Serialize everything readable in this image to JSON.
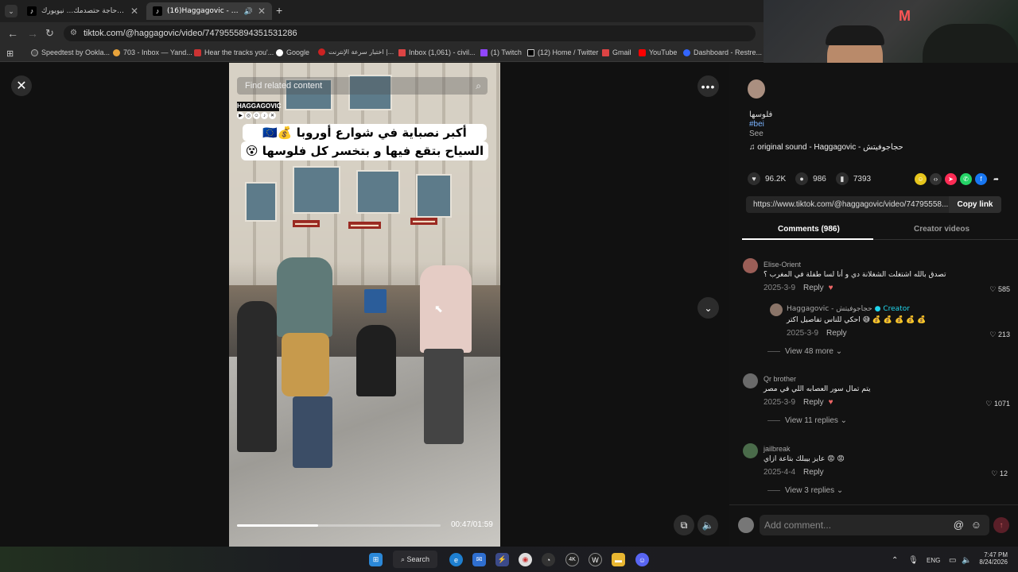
{
  "browser": {
    "tabs": [
      {
        "title": "أكثر حاجة حتصدمك... نيويورك ..."
      },
      {
        "title": "(16)Haggagovic - حجاجوفيتش"
      }
    ],
    "url": "tiktok.com/@haggagovic/video/7479555894351531286",
    "bookmarks": [
      "Speedtest by Ookla...",
      "703 - Inbox — Yand...",
      "Hear the tracks you'...",
      "Google",
      "اختبار سرعة الإنترنت |...",
      "Inbox (1,061) - civil...",
      "(1) Twitch",
      "(12) Home / Twitter",
      "Gmail",
      "YouTube",
      "Dashboard - Restre..."
    ]
  },
  "video": {
    "search_placeholder": "Find related content",
    "channel_tag": "HAGGAGOVIC",
    "caption_line1": "أكبر نصباية في شوارع أوروبا 💰🇪🇺",
    "caption_line2": "السياح بتقع فيها و بتخسر كل فلوسها 😵",
    "time": "00:47/01:59",
    "progress": 0.4
  },
  "panel": {
    "partial_text_1": "فلوسها",
    "partial_text_2": "#bei",
    "partial_text_3": "See",
    "sound": "original sound - Haggagovic - حجاجوفيتش",
    "likes": "96.2K",
    "comments": "986",
    "saves": "7393",
    "link": "https://www.tiktok.com/@haggagovic/video/74795558...",
    "copy_link": "Copy link",
    "tab_comments": "Comments (986)",
    "tab_creator": "Creator videos",
    "comment_list": [
      {
        "user": "Elise-Orient",
        "text": "تصدق بالله اشتغلت الشغلانة دي و أنا لسا طفلة في المغرب ؟",
        "date": "2025-3-9",
        "reply": "Reply",
        "likes": "585"
      },
      {
        "user": "Haggagovic - حجاجوفيتش",
        "creator": "Creator",
        "text": "احكي للناس تفاصيل اكتر 😅 💰 💰 💰 💰 💰",
        "date": "2025-3-9",
        "reply": "Reply",
        "likes": "213"
      },
      {
        "user": "Qr brother",
        "text": "يتم تمال سور العصابه اللي في مصر",
        "date": "2025-3-9",
        "reply": "Reply",
        "likes": "1071"
      },
      {
        "user": "jailbreak",
        "text": "عايز بيبلك بتاعة ازاي 😡 😡",
        "date": "2025-4-4",
        "reply": "Reply",
        "likes": "12"
      }
    ],
    "view_more_1": "View 48 more",
    "view_replies_2": "View 11 replies",
    "view_replies_3": "View 3 replies",
    "add_comment": "Add comment..."
  },
  "taskbar": {
    "search": "Search",
    "lang": "ENG",
    "time": "7:47 PM",
    "date": "8/24/2026"
  }
}
